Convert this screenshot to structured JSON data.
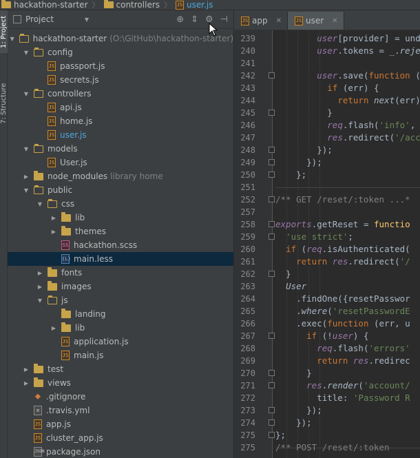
{
  "breadcrumb": [
    {
      "label": "hackathon-starter",
      "icon": "folder-icon",
      "active": false
    },
    {
      "label": "controllers",
      "icon": "folder-icon",
      "active": false
    },
    {
      "label": "user.js",
      "icon": "js-file-icon",
      "active": true
    }
  ],
  "side_tabs": {
    "project": "1: Project",
    "structure": "7: Structure"
  },
  "panel": {
    "selector_label": "Project",
    "tools": [
      "target-icon",
      "collapse-icon",
      "gear-icon",
      "hide-icon"
    ]
  },
  "tree": [
    {
      "indent": 0,
      "arrow": "open",
      "icon": "folder-open",
      "label": "hackathon-starter",
      "suffix": "(O:\\GitHub\\hackathon-starter)"
    },
    {
      "indent": 1,
      "arrow": "open",
      "icon": "folder-open",
      "label": "config"
    },
    {
      "indent": 2,
      "arrow": "",
      "icon": "js",
      "label": "passport.js"
    },
    {
      "indent": 2,
      "arrow": "",
      "icon": "js",
      "label": "secrets.js"
    },
    {
      "indent": 1,
      "arrow": "open",
      "icon": "folder-open",
      "label": "controllers"
    },
    {
      "indent": 2,
      "arrow": "",
      "icon": "js",
      "label": "api.js"
    },
    {
      "indent": 2,
      "arrow": "",
      "icon": "js",
      "label": "home.js"
    },
    {
      "indent": 2,
      "arrow": "",
      "icon": "js",
      "label": "user.js",
      "highlight": true
    },
    {
      "indent": 1,
      "arrow": "open",
      "icon": "folder-open",
      "label": "models"
    },
    {
      "indent": 2,
      "arrow": "",
      "icon": "js",
      "label": "User.js"
    },
    {
      "indent": 1,
      "arrow": "closed",
      "icon": "folder",
      "label": "node_modules",
      "suffix": "library home"
    },
    {
      "indent": 1,
      "arrow": "open",
      "icon": "folder-open",
      "label": "public"
    },
    {
      "indent": 2,
      "arrow": "open",
      "icon": "folder-open",
      "label": "css"
    },
    {
      "indent": 3,
      "arrow": "closed",
      "icon": "folder",
      "label": "lib"
    },
    {
      "indent": 3,
      "arrow": "closed",
      "icon": "folder",
      "label": "themes"
    },
    {
      "indent": 3,
      "arrow": "",
      "icon": "scss",
      "label": "hackathon.scss"
    },
    {
      "indent": 3,
      "arrow": "",
      "icon": "less",
      "label": "main.less",
      "selected": true
    },
    {
      "indent": 2,
      "arrow": "closed",
      "icon": "folder",
      "label": "fonts"
    },
    {
      "indent": 2,
      "arrow": "closed",
      "icon": "folder",
      "label": "images"
    },
    {
      "indent": 2,
      "arrow": "open",
      "icon": "folder-open",
      "label": "js"
    },
    {
      "indent": 3,
      "arrow": "",
      "icon": "folder",
      "label": "landing"
    },
    {
      "indent": 3,
      "arrow": "closed",
      "icon": "folder",
      "label": "lib"
    },
    {
      "indent": 3,
      "arrow": "",
      "icon": "js",
      "label": "application.js"
    },
    {
      "indent": 3,
      "arrow": "",
      "icon": "js",
      "label": "main.js"
    },
    {
      "indent": 1,
      "arrow": "closed",
      "icon": "folder",
      "label": "test"
    },
    {
      "indent": 1,
      "arrow": "closed",
      "icon": "folder",
      "label": "views"
    },
    {
      "indent": 1,
      "arrow": "",
      "icon": "git",
      "label": ".gitignore"
    },
    {
      "indent": 1,
      "arrow": "",
      "icon": "yml",
      "label": ".travis.yml"
    },
    {
      "indent": 1,
      "arrow": "",
      "icon": "js",
      "label": "app.js"
    },
    {
      "indent": 1,
      "arrow": "",
      "icon": "js",
      "label": "cluster_app.js"
    },
    {
      "indent": 1,
      "arrow": "",
      "icon": "json",
      "label": "package.json"
    }
  ],
  "editor_tabs": [
    {
      "label": "app",
      "selected": false
    },
    {
      "label": "user",
      "selected": true
    }
  ],
  "line_numbers": [
    "239",
    "240",
    "241",
    "242",
    "243",
    "244",
    "245",
    "246",
    "247",
    "248",
    "249",
    "250",
    "251",
    "252",
    "257",
    "258",
    "259",
    "260",
    "261",
    "262",
    "263",
    "264",
    "265",
    "266",
    "267",
    "268",
    "269",
    "270",
    "271",
    "272",
    "273",
    "274",
    "275"
  ],
  "code_lines": [
    [
      [
        "",
        "        "
      ],
      [
        "p",
        "user"
      ],
      [
        "",
        "[provider] = undef"
      ]
    ],
    [
      [
        "",
        "        "
      ],
      [
        "p",
        "user"
      ],
      [
        "",
        ".tokens = _."
      ],
      [
        "i",
        "reject"
      ]
    ],
    [
      [
        "",
        ""
      ]
    ],
    [
      [
        "",
        "        "
      ],
      [
        "p",
        "user"
      ],
      [
        "",
        ".save("
      ],
      [
        "k",
        "function"
      ],
      [
        "",
        " (err"
      ]
    ],
    [
      [
        "",
        "          "
      ],
      [
        "k",
        "if"
      ],
      [
        "",
        " (err) {"
      ]
    ],
    [
      [
        "",
        "            "
      ],
      [
        "k",
        "return"
      ],
      [
        "",
        " "
      ],
      [
        "i",
        "next"
      ],
      [
        "",
        "(err);"
      ]
    ],
    [
      [
        "",
        "          }"
      ]
    ],
    [
      [
        "",
        "          "
      ],
      [
        "p",
        "req"
      ],
      [
        "",
        ".flash("
      ],
      [
        "s",
        "'info'"
      ],
      [
        "",
        ", {m"
      ]
    ],
    [
      [
        "",
        "          "
      ],
      [
        "p",
        "res"
      ],
      [
        "",
        ".redirect("
      ],
      [
        "s",
        "'/accou"
      ]
    ],
    [
      [
        "",
        "        });"
      ]
    ],
    [
      [
        "",
        "      });"
      ]
    ],
    [
      [
        "",
        "    };"
      ]
    ],
    [
      [
        "",
        ""
      ]
    ],
    [
      [
        "c",
        "/** GET /reset/:token ...*"
      ]
    ],
    [
      [
        "",
        ""
      ]
    ],
    [
      [
        "p",
        "exports"
      ],
      [
        "",
        ".getReset = "
      ],
      [
        "f",
        "functio"
      ]
    ],
    [
      [
        "",
        "  "
      ],
      [
        "s",
        "'use strict'"
      ],
      [
        "",
        ";"
      ]
    ],
    [
      [
        "",
        "  "
      ],
      [
        "k",
        "if"
      ],
      [
        "",
        " ("
      ],
      [
        "p",
        "req"
      ],
      [
        "",
        ".isAuthenticated("
      ]
    ],
    [
      [
        "",
        "    "
      ],
      [
        "k",
        "return"
      ],
      [
        "",
        " "
      ],
      [
        "p",
        "res"
      ],
      [
        "",
        ".redirect("
      ],
      [
        "s",
        "'/"
      ]
    ],
    [
      [
        "",
        "  }"
      ]
    ],
    [
      [
        "",
        "  "
      ],
      [
        "i",
        "User"
      ]
    ],
    [
      [
        "",
        "    .findOne({resetPasswor"
      ]
    ],
    [
      [
        "",
        "    ."
      ],
      [
        "i",
        "where"
      ],
      [
        "",
        "("
      ],
      [
        "s",
        "'resetPasswordE"
      ]
    ],
    [
      [
        "",
        "    .exec("
      ],
      [
        "k",
        "function"
      ],
      [
        "",
        " (err, u"
      ]
    ],
    [
      [
        "",
        "      "
      ],
      [
        "k",
        "if"
      ],
      [
        "",
        " (!"
      ],
      [
        "p",
        "user"
      ],
      [
        "",
        ") {"
      ]
    ],
    [
      [
        "",
        "        "
      ],
      [
        "p",
        "req"
      ],
      [
        "",
        ".flash("
      ],
      [
        "s",
        "'errors'"
      ]
    ],
    [
      [
        "",
        "        "
      ],
      [
        "k",
        "return"
      ],
      [
        "",
        " "
      ],
      [
        "p",
        "res"
      ],
      [
        "",
        ".redirec"
      ]
    ],
    [
      [
        "",
        "      }"
      ]
    ],
    [
      [
        "",
        "      "
      ],
      [
        "p",
        "res"
      ],
      [
        "",
        "."
      ],
      [
        "i",
        "render"
      ],
      [
        "",
        "("
      ],
      [
        "s",
        "'account/"
      ]
    ],
    [
      [
        "",
        "        title: "
      ],
      [
        "s",
        "'Password R"
      ]
    ],
    [
      [
        "",
        "      });"
      ]
    ],
    [
      [
        "",
        "    });"
      ]
    ],
    [
      [
        "",
        "};"
      ]
    ]
  ],
  "trailing_line": {
    "number": "275",
    "text": "/** POST /reset/:token"
  }
}
